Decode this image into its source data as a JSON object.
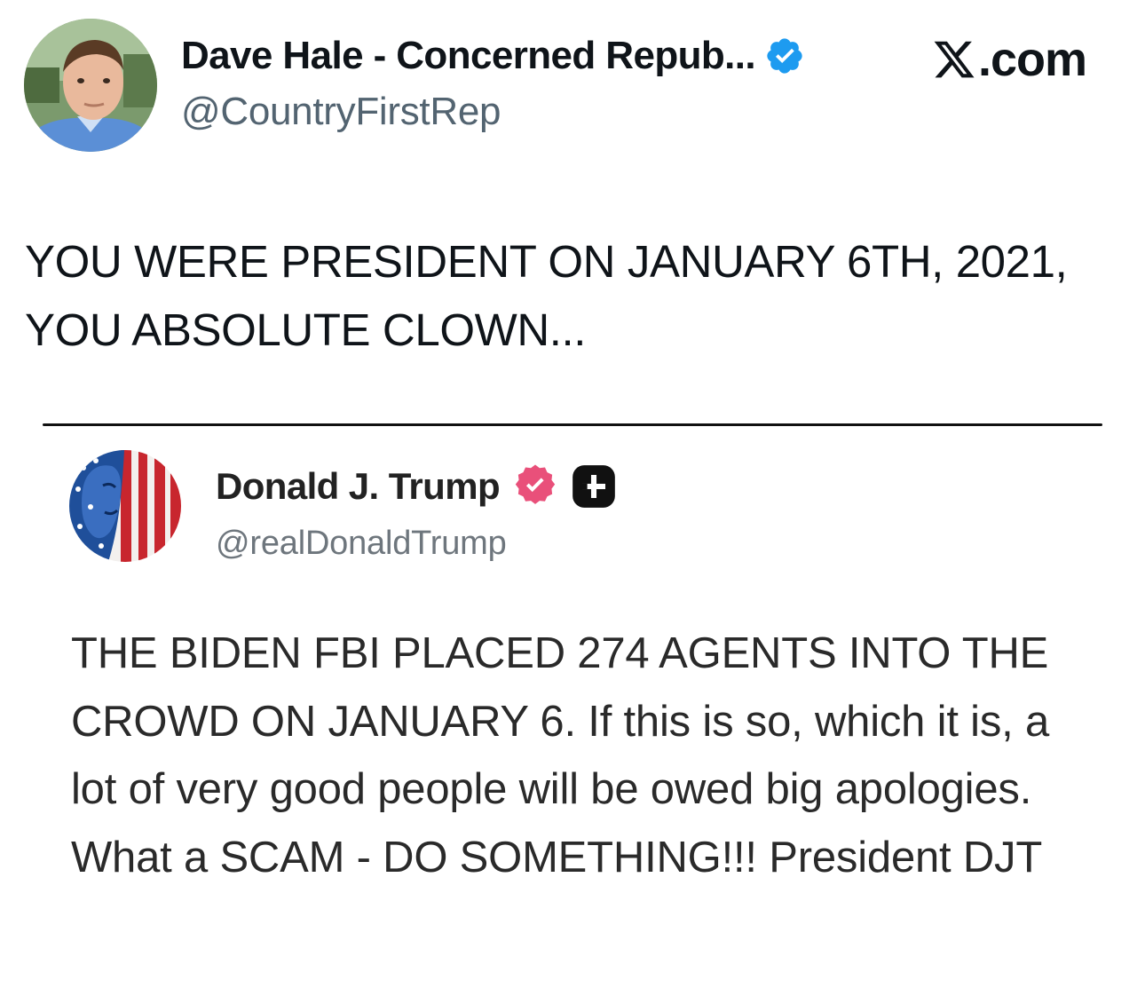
{
  "outer_tweet": {
    "author_name": "Dave Hale - Concerned Repub...",
    "handle": "@CountryFirstRep",
    "source_label": ".com",
    "avatar_icon": "profile-photo-avatar",
    "verified_icon": "verified-badge-blue-icon",
    "text": "YOU WERE PRESIDENT ON JANUARY 6TH, 2021, YOU ABSOLUTE CLOWN..."
  },
  "embedded_post": {
    "author_name": "Donald J. Trump",
    "handle": "@realDonaldTrump",
    "avatar_icon": "flag-portrait-avatar",
    "verified_icon": "verified-badge-pink-icon",
    "extra_badge_icon": "plus-badge-icon",
    "text": "THE BIDEN FBI PLACED 274 AGENTS INTO THE CROWD ON JANUARY 6. If this is so, which it is, a lot of very good people will be owed big apologies. What a SCAM - DO SOMETHING!!! President DJT"
  },
  "colors": {
    "x_blue_verified": "#1d9bf0",
    "truth_pink_verified": "#e9507a",
    "handle_gray": "#536471",
    "text_dark": "#0f1419"
  }
}
